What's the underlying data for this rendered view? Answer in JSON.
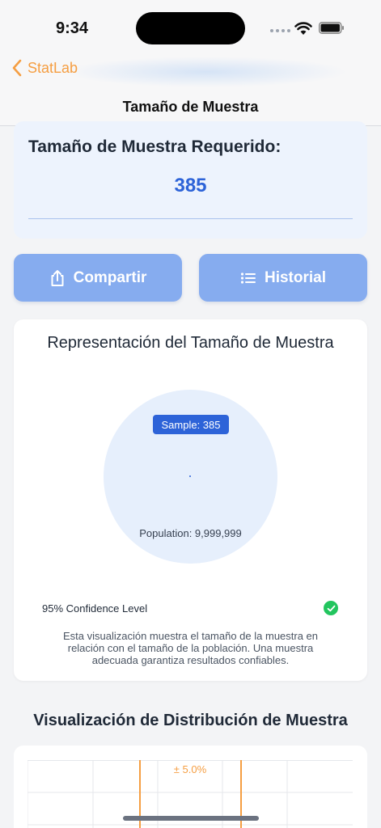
{
  "status": {
    "time": "9:34"
  },
  "nav": {
    "back_label": "StatLab",
    "title": "Tamaño de Muestra"
  },
  "result": {
    "title": "Tamaño de Muestra Requerido:",
    "value": "385"
  },
  "actions": {
    "share_label": "Compartir",
    "history_label": "Historial"
  },
  "visualization": {
    "title": "Representación del Tamaño de Muestra",
    "sample_badge": "Sample: 385",
    "population_label": "Population: 9,999,999",
    "confidence_label": "95% Confidence Level",
    "description": "Esta visualización muestra el tamaño de la muestra en relación con el tamaño de la población. Una muestra adecuada garantiza resultados confiables."
  },
  "distribution": {
    "title": "Visualización de Distribución de Muestra",
    "margin_label": "± 5.0%"
  },
  "colors": {
    "accent": "#f59e42",
    "primary": "#2d63d8",
    "button": "#86acef",
    "success": "#22c55e"
  },
  "icons": {
    "back": "chevron-left-icon",
    "share": "share-icon",
    "history": "list-icon",
    "check": "checkmark-icon"
  }
}
